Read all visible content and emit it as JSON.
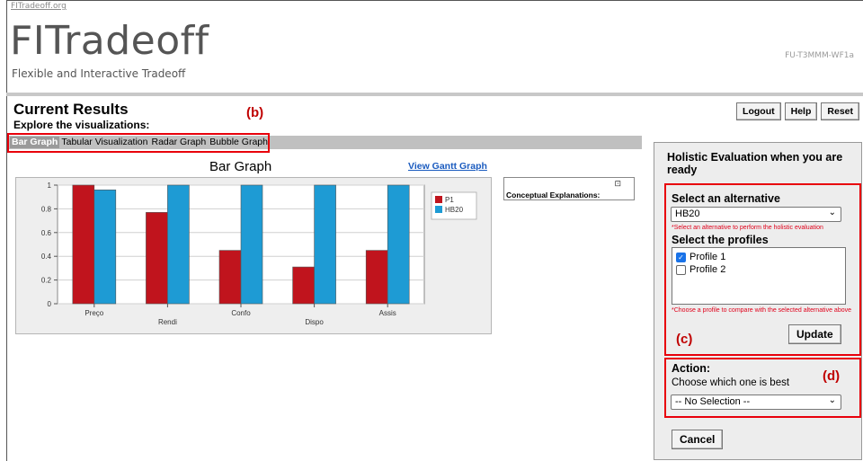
{
  "header": {
    "site_link": "FITradeoff.org",
    "brand": "FITradeoff",
    "tagline": "Flexible and Interactive Tradeoff",
    "code": "FU-T3MMM-WF1a"
  },
  "results": {
    "title": "Current Results",
    "subtitle": "Explore the visualizations:"
  },
  "top_buttons": {
    "logout": "Logout",
    "help": "Help",
    "reset": "Reset"
  },
  "tabs": [
    "Bar Graph",
    "Tabular Visualization",
    "Radar Graph",
    "Bubble Graph"
  ],
  "annotations": {
    "b": "(b)",
    "c": "(c)",
    "d": "(d)"
  },
  "chart_section": {
    "title": "Bar Graph",
    "gantt_link": "View Gantt Graph"
  },
  "conceptual": {
    "label": "Conceptual Explanations:",
    "icon": "expand-icon"
  },
  "side_panel": {
    "holistic_title": "Holistic Evaluation when you are ready",
    "select_alt_label": "Select an alternative",
    "select_alt_value": "HB20",
    "select_alt_hint": "*Select an alternative to perform the holistic evaluation",
    "select_profiles_label": "Select the profiles",
    "profiles": [
      {
        "label": "Profile 1",
        "checked": true
      },
      {
        "label": "Profile 2",
        "checked": false
      }
    ],
    "profiles_hint": "*Choose a profile to compare with the selected alternative above",
    "update": "Update",
    "action_label": "Action:",
    "action_hint": "Choose which one is best",
    "action_value": "-- No Selection --",
    "cancel": "Cancel"
  },
  "colors": {
    "p1": "#c0141d",
    "hb20": "#1e9bd4",
    "annotation": "#e8000b"
  },
  "chart_data": {
    "type": "bar",
    "categories": [
      "Preço",
      "Rendi",
      "Confo",
      "Dispo",
      "Assis"
    ],
    "series": [
      {
        "name": "P1",
        "values": [
          1.0,
          0.77,
          0.45,
          0.31,
          0.45
        ]
      },
      {
        "name": "HB20",
        "values": [
          0.96,
          1.0,
          1.0,
          1.0,
          1.0
        ]
      }
    ],
    "ylim": [
      0,
      1
    ],
    "yticks": [
      "0",
      "0.2",
      "0.4",
      "0.6",
      "0.8",
      "1"
    ],
    "legend": "right",
    "grid": true
  }
}
